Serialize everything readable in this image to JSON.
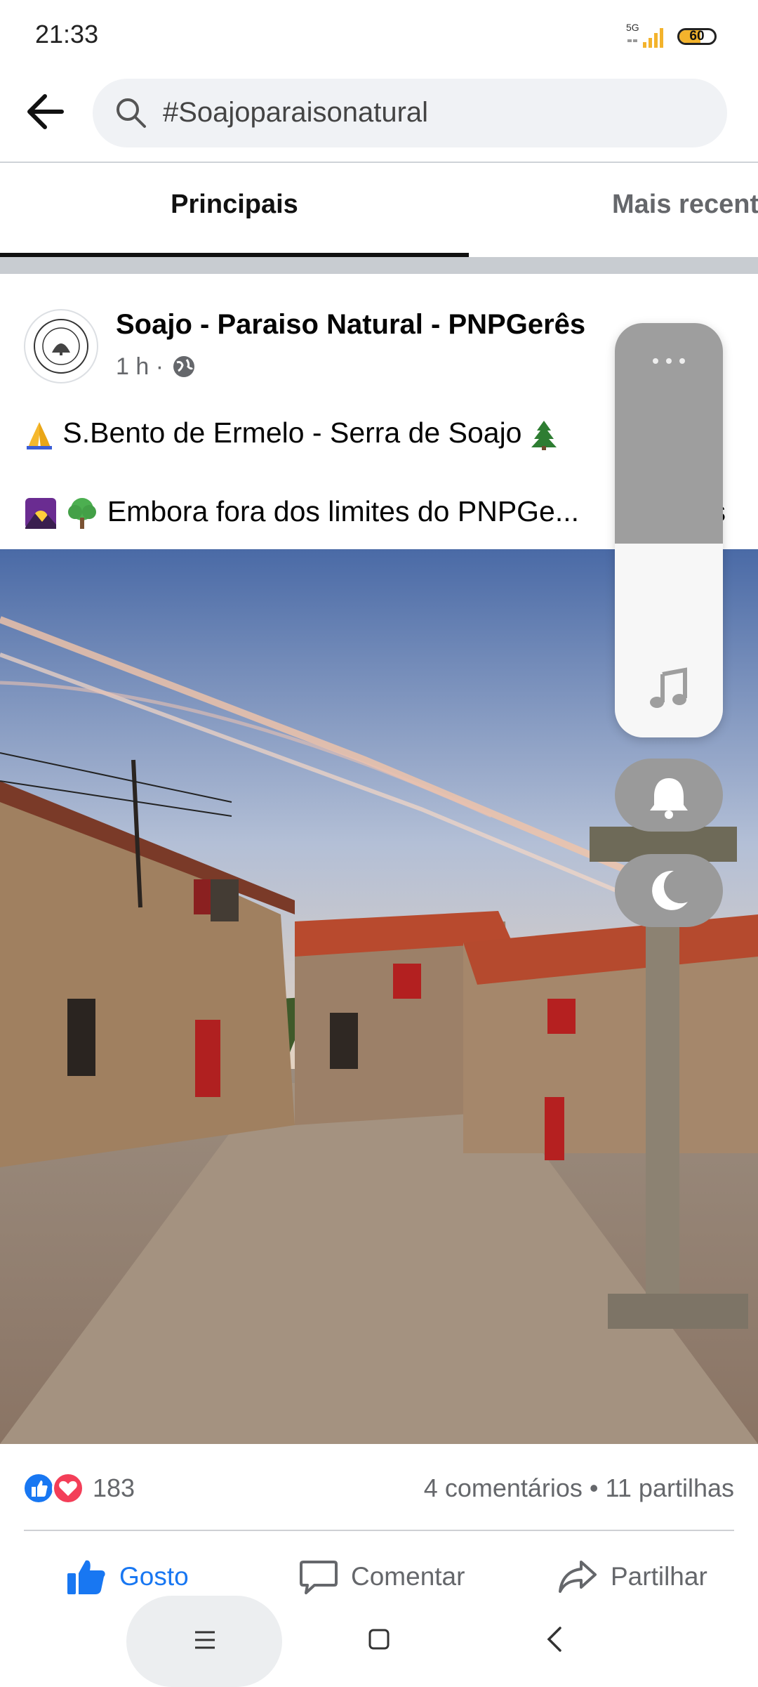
{
  "status_bar": {
    "time": "21:33",
    "network": "5G",
    "battery_level": "60",
    "battery_fraction": 0.6,
    "icons": [
      "signal-5g-icon",
      "battery-icon"
    ]
  },
  "search": {
    "query": "#Soajoparaisonatural",
    "icons": [
      "back-arrow-icon",
      "search-icon"
    ]
  },
  "tabs": [
    {
      "label": "Principais",
      "selected": true
    },
    {
      "label": "Mais recentes",
      "selected": false
    }
  ],
  "post": {
    "page_name": "Soajo - Paraiso Natural  - PNPGerês",
    "time": "1 h",
    "separator": "·",
    "privacy_icon": "globe-icon",
    "line1": "S.Bento de Ermelo - Serra de Soajo",
    "line1_icons": [
      "praying-hands-icon",
      "evergreen-tree-icon"
    ],
    "line2": "Embora fora dos limites do PNPGe...",
    "line2_truncated_suffix": "s",
    "line2_icons": [
      "sunrise-mountains-icon",
      "deciduous-tree-icon"
    ],
    "image_description_icon": "village-street-photo"
  },
  "reactions": {
    "count": "183",
    "types": [
      "like-reaction-icon",
      "love-reaction-icon"
    ],
    "comments": "4 comentários",
    "dot": "•",
    "shares": "11 partilhas"
  },
  "actions": {
    "like": "Gosto",
    "comment": "Comentar",
    "share": "Partilhar"
  },
  "side_panel": {
    "icons": [
      "more-icon",
      "music-note-icon",
      "bell-icon",
      "moon-icon"
    ]
  },
  "nav": {
    "icons": [
      "menu-icon",
      "home-square-icon",
      "back-chevron-icon"
    ]
  },
  "colors": {
    "accent": "#1877f2",
    "love": "#f33e58",
    "secondary_text": "#65676b",
    "panel_gray": "#9e9e9e"
  }
}
